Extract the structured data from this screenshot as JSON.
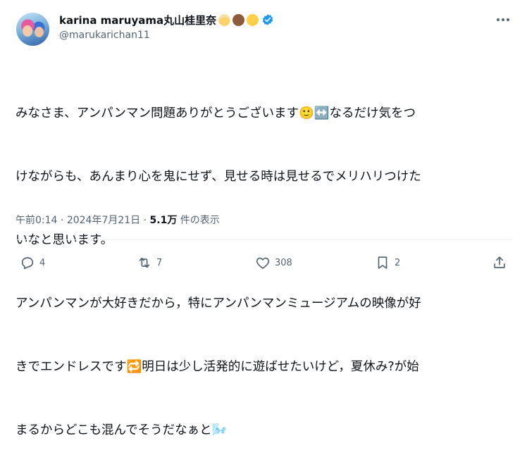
{
  "author": {
    "display_name": "karina maruyama丸山桂里奈",
    "handle": "@marukarichan11",
    "name_emojis": [
      "woman-blond-hair-emoji",
      "man-beard-emoji",
      "baby-angel-emoji"
    ],
    "verified": true
  },
  "post": {
    "lines": [
      "みなさま、アンパンマン問題ありがとうございます🙂↔️なるだけ気をつ",
      "けながらも、あんまり心を鬼にせず、見せる時は見せるでメリハリつけた",
      "いなと思います。",
      "アンパンマンが大好きだから，特にアンパンマンミュージアムの映像が好",
      "きでエンドレスです🔁明日は少し活発的に遊ばせたいけど，夏休み?が始",
      "まるからどこも混んでそうだなぁと🌬️"
    ]
  },
  "meta": {
    "time": "午前0:14",
    "sep": "·",
    "date": "2024年7月21日",
    "views_count": "5.1万",
    "views_label": "件の表示"
  },
  "actions": {
    "replies": "4",
    "reposts": "7",
    "likes": "308",
    "bookmarks": "2"
  },
  "colors": {
    "text": "#0f1419",
    "secondary": "#536471",
    "verified": "#1d9bf0",
    "divider": "#eff3f4"
  }
}
